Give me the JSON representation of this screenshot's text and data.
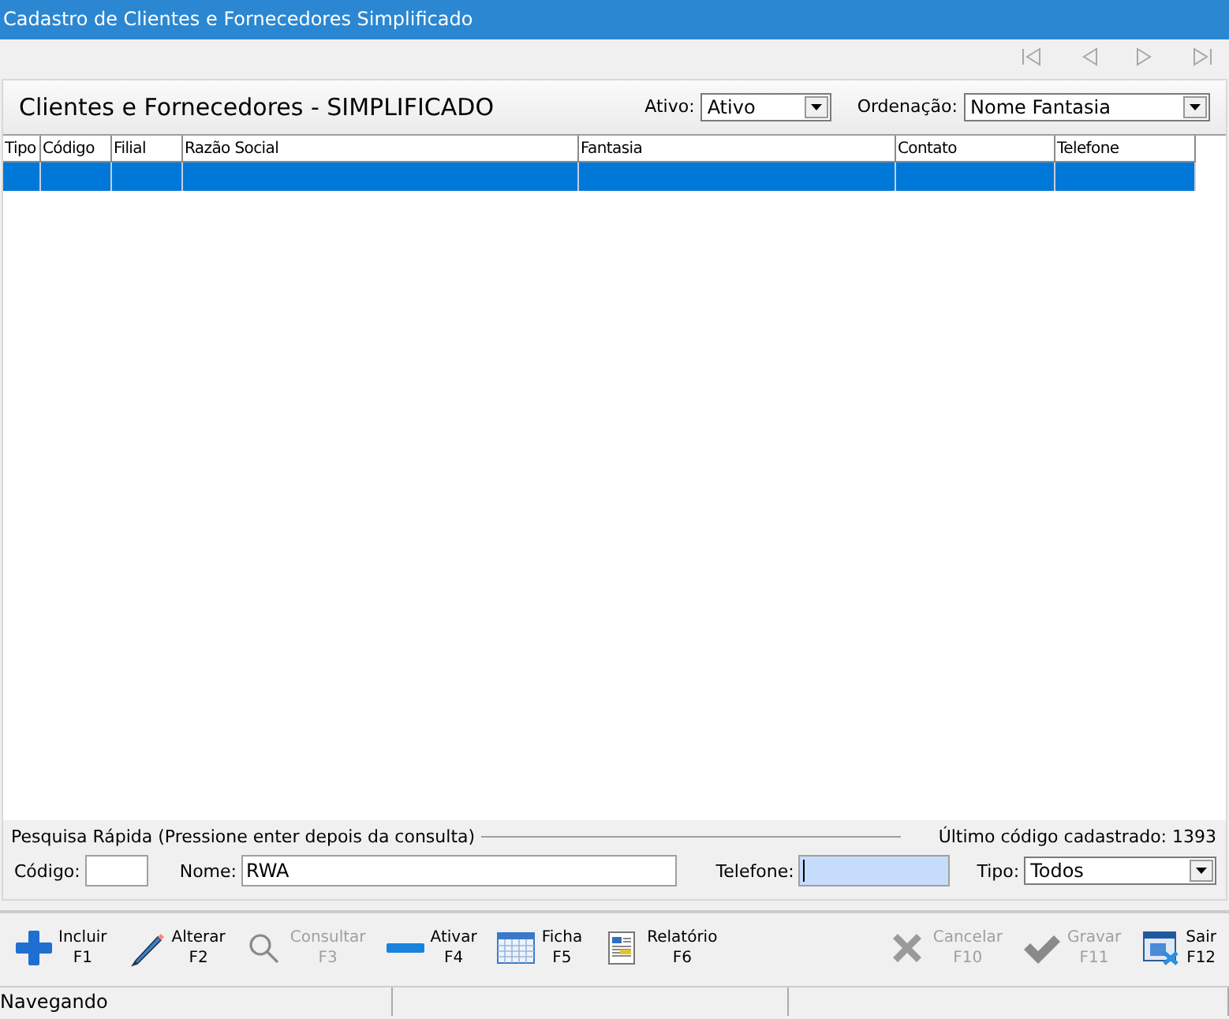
{
  "window": {
    "title": "Cadastro de Clientes e Fornecedores Simplificado"
  },
  "nav_buttons": [
    {
      "disabled": true
    },
    {
      "disabled": true
    },
    {
      "disabled": true
    },
    {
      "disabled": true
    }
  ],
  "header": {
    "title": "Clientes e Fornecedores - SIMPLIFICADO",
    "ativo_label": "Ativo:",
    "ativo_value": "Ativo",
    "ordenacao_label": "Ordenação:",
    "ordenacao_value": "Nome Fantasia"
  },
  "table": {
    "columns": [
      "Tipo",
      "Código",
      "Filial",
      "Razão Social",
      "Fantasia",
      "Contato",
      "Telefone"
    ],
    "rows": [
      {
        "selected": true
      }
    ]
  },
  "quick_search": {
    "title": "Pesquisa Rápida (Pressione enter depois da consulta)",
    "last_code": "Último código cadastrado: 1393",
    "codigo_label": "Código:",
    "nome_label": "Nome:",
    "nome_value": "RWA",
    "telefone_label": "Telefone:",
    "tipo_label": "Tipo:",
    "tipo_value": "Todos"
  },
  "toolbar": [
    {
      "label": "Incluir",
      "key": "F1",
      "disabled": false
    },
    {
      "label": "Alterar",
      "key": "F2",
      "disabled": false
    },
    {
      "label": "Consultar",
      "key": "F3",
      "disabled": true
    },
    {
      "label": "Ativar",
      "key": "F4",
      "disabled": false
    },
    {
      "label": "Ficha",
      "key": "F5",
      "disabled": false
    },
    {
      "label": "Relatório",
      "key": "F6",
      "disabled": false
    },
    {
      "label": "Cancelar",
      "key": "F10",
      "disabled": true
    },
    {
      "label": "Gravar",
      "key": "F11",
      "disabled": true
    },
    {
      "label": "Sair",
      "key": "F12",
      "disabled": false
    }
  ],
  "status_bar": [
    "Navegando"
  ]
}
